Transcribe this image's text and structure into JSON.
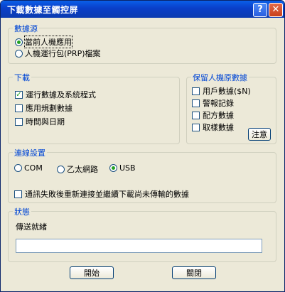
{
  "window": {
    "title": "下載數據至觸控屏"
  },
  "titlebar": {
    "help_label": "?",
    "close_label": "✕"
  },
  "source": {
    "legend": "數據源",
    "options": [
      {
        "label": "當前人機應用",
        "selected": true
      },
      {
        "label": "人機運行包(PRP)檔案",
        "selected": false
      }
    ]
  },
  "download": {
    "legend": "下載",
    "items": [
      {
        "label": "運行數據及系統程式",
        "checked": true
      },
      {
        "label": "應用規劃數據",
        "checked": false
      },
      {
        "label": "時間與日期",
        "checked": false
      }
    ]
  },
  "retain": {
    "legend": "保留人機原數據",
    "items": [
      {
        "label": "用戶數據($N)",
        "checked": false
      },
      {
        "label": "警報記錄",
        "checked": false
      },
      {
        "label": "配方數據",
        "checked": false
      },
      {
        "label": "取樣數據",
        "checked": false
      }
    ],
    "note_button": "注意"
  },
  "connection": {
    "legend": "連線設置",
    "options": [
      {
        "label": "COM",
        "selected": false
      },
      {
        "label": "乙太網路",
        "selected": false
      },
      {
        "label": "USB",
        "selected": true
      }
    ],
    "resume_label": "通訊失敗後重新連接並繼續下載尚未傳輸的數據",
    "resume_checked": false
  },
  "status": {
    "legend": "狀態",
    "text": "傳送就緒",
    "value": ""
  },
  "buttons": {
    "start": "開始",
    "close": "關閉"
  }
}
